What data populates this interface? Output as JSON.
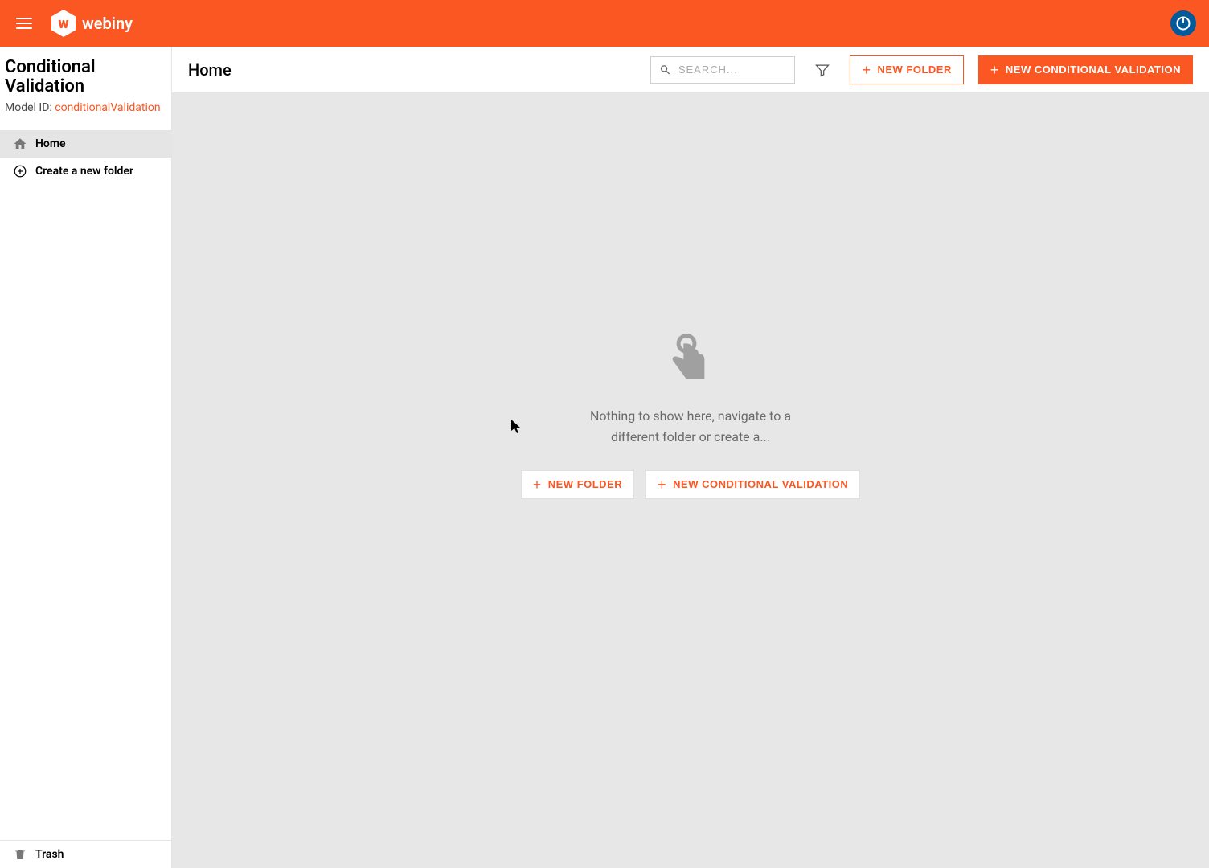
{
  "header": {
    "brand": "webiny"
  },
  "sidebar": {
    "title": "Conditional Validation",
    "modelIdLabel": "Model ID: ",
    "modelIdValue": "conditionalValidation",
    "items": [
      {
        "label": "Home",
        "icon": "home-icon",
        "active": true
      },
      {
        "label": "Create a new folder",
        "icon": "plus-circle-icon",
        "active": false
      }
    ],
    "footer": {
      "trash": "Trash"
    }
  },
  "main": {
    "breadcrumb": "Home",
    "search": {
      "placeholder": "SEARCH..."
    },
    "buttons": {
      "newFolder": "NEW FOLDER",
      "newEntry": "NEW CONDITIONAL VALIDATION"
    },
    "empty": {
      "message": "Nothing to show here, navigate to a different folder or create a...",
      "newFolder": "NEW FOLDER",
      "newEntry": "NEW CONDITIONAL VALIDATION"
    }
  },
  "colors": {
    "accent": "#FA5723"
  }
}
